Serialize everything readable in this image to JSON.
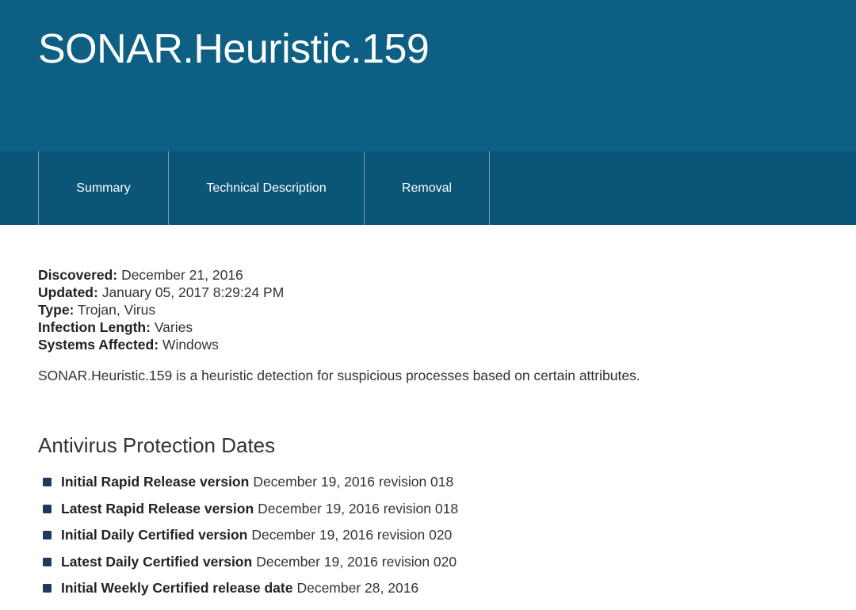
{
  "header": {
    "title": "SONAR.Heuristic.159"
  },
  "tabs": [
    {
      "label": "Summary"
    },
    {
      "label": "Technical Description"
    },
    {
      "label": "Removal"
    }
  ],
  "meta": {
    "discovered": {
      "label": "Discovered:",
      "value": "December 21, 2016"
    },
    "updated": {
      "label": "Updated:",
      "value": "January 05, 2017 8:29:24 PM"
    },
    "type": {
      "label": "Type:",
      "value": "Trojan, Virus"
    },
    "infection_length": {
      "label": "Infection Length:",
      "value": "Varies"
    },
    "systems_affected": {
      "label": "Systems Affected:",
      "value": "Windows"
    }
  },
  "description": "SONAR.Heuristic.159 is a heuristic detection for suspicious processes based on certain attributes.",
  "protection": {
    "title": "Antivirus Protection Dates",
    "items": [
      {
        "label": "Initial Rapid Release version",
        "value": "December 19, 2016 revision 018"
      },
      {
        "label": "Latest Rapid Release version",
        "value": "December 19, 2016 revision 018"
      },
      {
        "label": "Initial Daily Certified version",
        "value": "December 19, 2016 revision 020"
      },
      {
        "label": "Latest Daily Certified version",
        "value": "December 19, 2016 revision 020"
      },
      {
        "label": "Initial Weekly Certified release date",
        "value": "December 28, 2016"
      }
    ]
  },
  "colors": {
    "header_bg": "#0d5f84",
    "tabbar_bg": "#0a5578",
    "bullet": "#1d3a5c"
  }
}
